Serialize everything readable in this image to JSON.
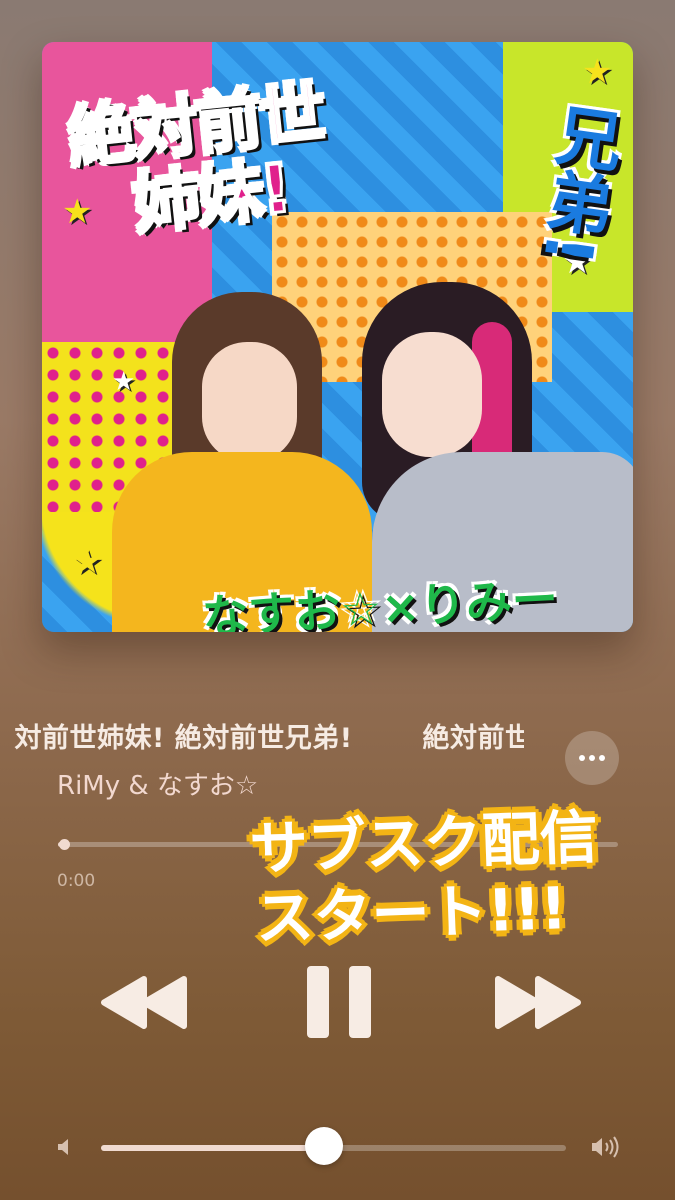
{
  "artwork": {
    "title_line1": "絶対前世",
    "title_line2": "姉妹!",
    "title_side": "兄弟!",
    "artist_line": "なすお☆×りみー"
  },
  "track": {
    "title": "絶対前世姉妹! 絶対前世兄弟!",
    "title_repeat": "絶対前世姉妹! 絶対前世兄弟!",
    "artist": "RiMy & なすお☆"
  },
  "playback": {
    "elapsed": "0:00",
    "progress_fraction": 0.01,
    "state": "playing",
    "volume_fraction": 0.48
  },
  "promo": {
    "line1": "サブスク配信",
    "line2": "スタート!!!"
  },
  "icons": {
    "more": "ellipsis-icon",
    "rewind": "rewind-icon",
    "pause": "pause-icon",
    "forward": "fast-forward-icon",
    "volume_low": "speaker-low-icon",
    "volume_high": "speaker-high-icon"
  },
  "colors": {
    "title_pink": "#e0208c",
    "side_blue": "#1a7be0",
    "artist_green": "#1fb84a",
    "promo_outline": "#f3b415",
    "control_fill": "#f7ece4"
  }
}
